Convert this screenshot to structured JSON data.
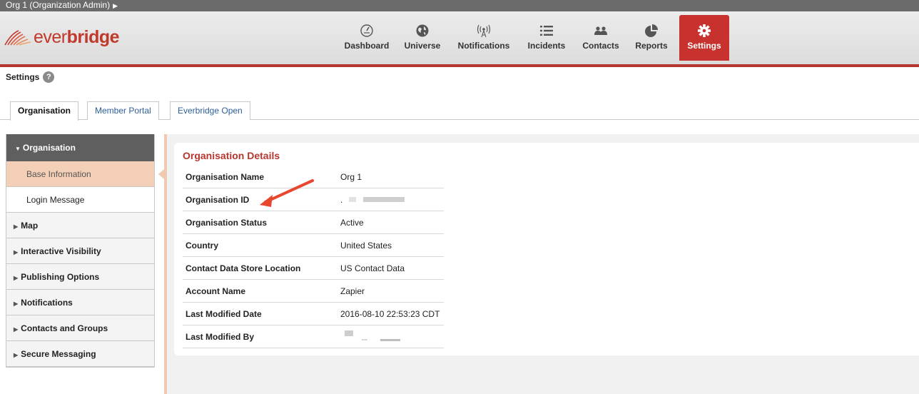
{
  "org_bar": {
    "label": "Org 1 (Organization Admin)",
    "caret": "▶"
  },
  "brand": {
    "logo_ever": "ever",
    "logo_bridge": "bridge"
  },
  "nav": {
    "items": [
      {
        "label": "Dashboard",
        "icon": "dashboard-icon"
      },
      {
        "label": "Universe",
        "icon": "globe-icon"
      },
      {
        "label": "Notifications",
        "icon": "broadcast-icon"
      },
      {
        "label": "Incidents",
        "icon": "list-icon"
      },
      {
        "label": "Contacts",
        "icon": "people-icon"
      },
      {
        "label": "Reports",
        "icon": "pie-chart-icon"
      },
      {
        "label": "Settings",
        "icon": "gear-icon",
        "active": true
      }
    ]
  },
  "page": {
    "title": "Settings",
    "help": "?"
  },
  "tabs": [
    {
      "label": "Organisation",
      "active": true
    },
    {
      "label": "Member Portal"
    },
    {
      "label": "Everbridge Open"
    }
  ],
  "sidebar": {
    "header": "Organisation",
    "sub_items": [
      {
        "label": "Base Information",
        "active": true
      },
      {
        "label": "Login Message"
      }
    ],
    "sections": [
      "Map",
      "Interactive Visibility",
      "Publishing Options",
      "Notifications",
      "Contacts and Groups",
      "Secure Messaging"
    ]
  },
  "details": {
    "title": "Organisation Details",
    "rows": [
      {
        "label": "Organisation Name",
        "value": "Org 1"
      },
      {
        "label": "Organisation ID",
        "value": "."
      },
      {
        "label": "Organisation Status",
        "value": "Active"
      },
      {
        "label": "Country",
        "value": "United States"
      },
      {
        "label": "Contact Data Store Location",
        "value": "US Contact Data"
      },
      {
        "label": "Account Name",
        "value": "Zapier"
      },
      {
        "label": "Last Modified Date",
        "value": "2016-08-10 22:53:23 CDT"
      },
      {
        "label": "Last Modified By",
        "value": ""
      }
    ]
  },
  "colors": {
    "brand_red": "#c8322e",
    "header_border": "#b5362f",
    "highlight": "#f4cfb7",
    "annotation": "#e8472f"
  }
}
